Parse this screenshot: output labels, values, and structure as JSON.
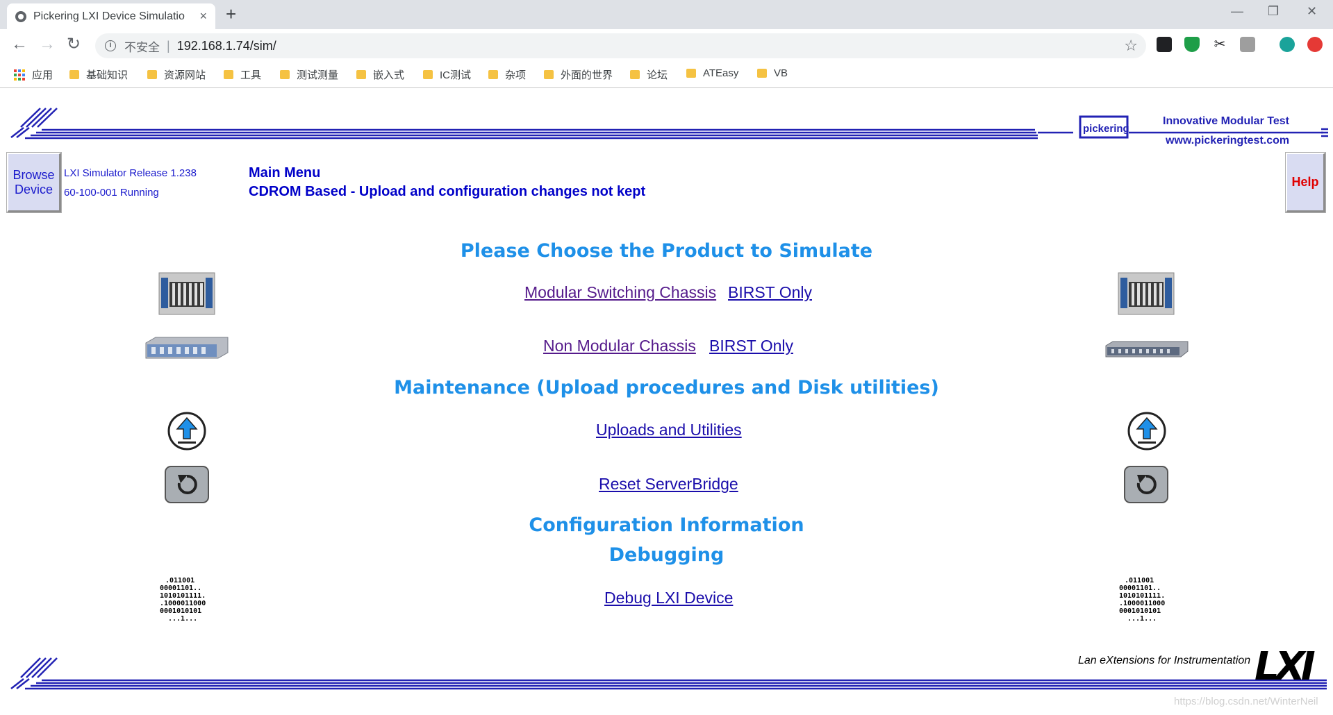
{
  "browser": {
    "tab_title": "Pickering LXI Device Simulatio",
    "new_tab": "+",
    "tab_close": "×",
    "security_label": "不安全",
    "separator": "|",
    "url": "192.168.1.74/sim/",
    "window_minimize": "—",
    "window_restore": "❐",
    "window_close": "✕"
  },
  "bookmarks": {
    "apps_label": "应用",
    "items": [
      "基础知识",
      "资源网站",
      "工具",
      "测试测量",
      "嵌入式",
      "IC测试",
      "杂项",
      "外面的世界",
      "论坛",
      "ATEasy",
      "VB"
    ]
  },
  "header": {
    "browse_device_line1": "Browse",
    "browse_device_line2": "Device",
    "release": "LXI Simulator Release 1.238",
    "status": "60-100-001 Running",
    "main_menu": "Main Menu",
    "cdrom_note": "CDROM Based - Upload and configuration changes not kept",
    "help": "Help",
    "pickering_logo": "pickering",
    "tagline": "Innovative Modular Test",
    "website": "www.pickeringtest.com"
  },
  "sections": {
    "choose_title": "Please Choose the Product to Simulate",
    "modular_chassis": "Modular Switching Chassis",
    "birst_only_1": "BIRST Only",
    "non_modular_chassis": "Non Modular Chassis",
    "birst_only_2": "BIRST Only",
    "maintenance_title": "Maintenance (Upload procedures and Disk utilities)",
    "uploads": "Uploads and Utilities",
    "reset": "Reset ServerBridge",
    "config_title": "Configuration Information",
    "debug_title": "Debugging",
    "debug_link": "Debug LXI Device"
  },
  "binary_text": [
    ".011001",
    "00001101..",
    "1010101111.",
    ".1000011000",
    "0001010101",
    "...1..."
  ],
  "footer": {
    "lxi_tagline": "Lan eXtensions for Instrumentation",
    "lxi_logo": "LXI",
    "watermark": "https://blog.csdn.net/WinterNeil"
  },
  "colors": {
    "heading": "#1e90e8",
    "link_visited": "#551a8b",
    "link": "#1a0dab",
    "brand_blue": "#2222b4",
    "button_face": "#d9dcf2",
    "help_text": "#e00000"
  }
}
